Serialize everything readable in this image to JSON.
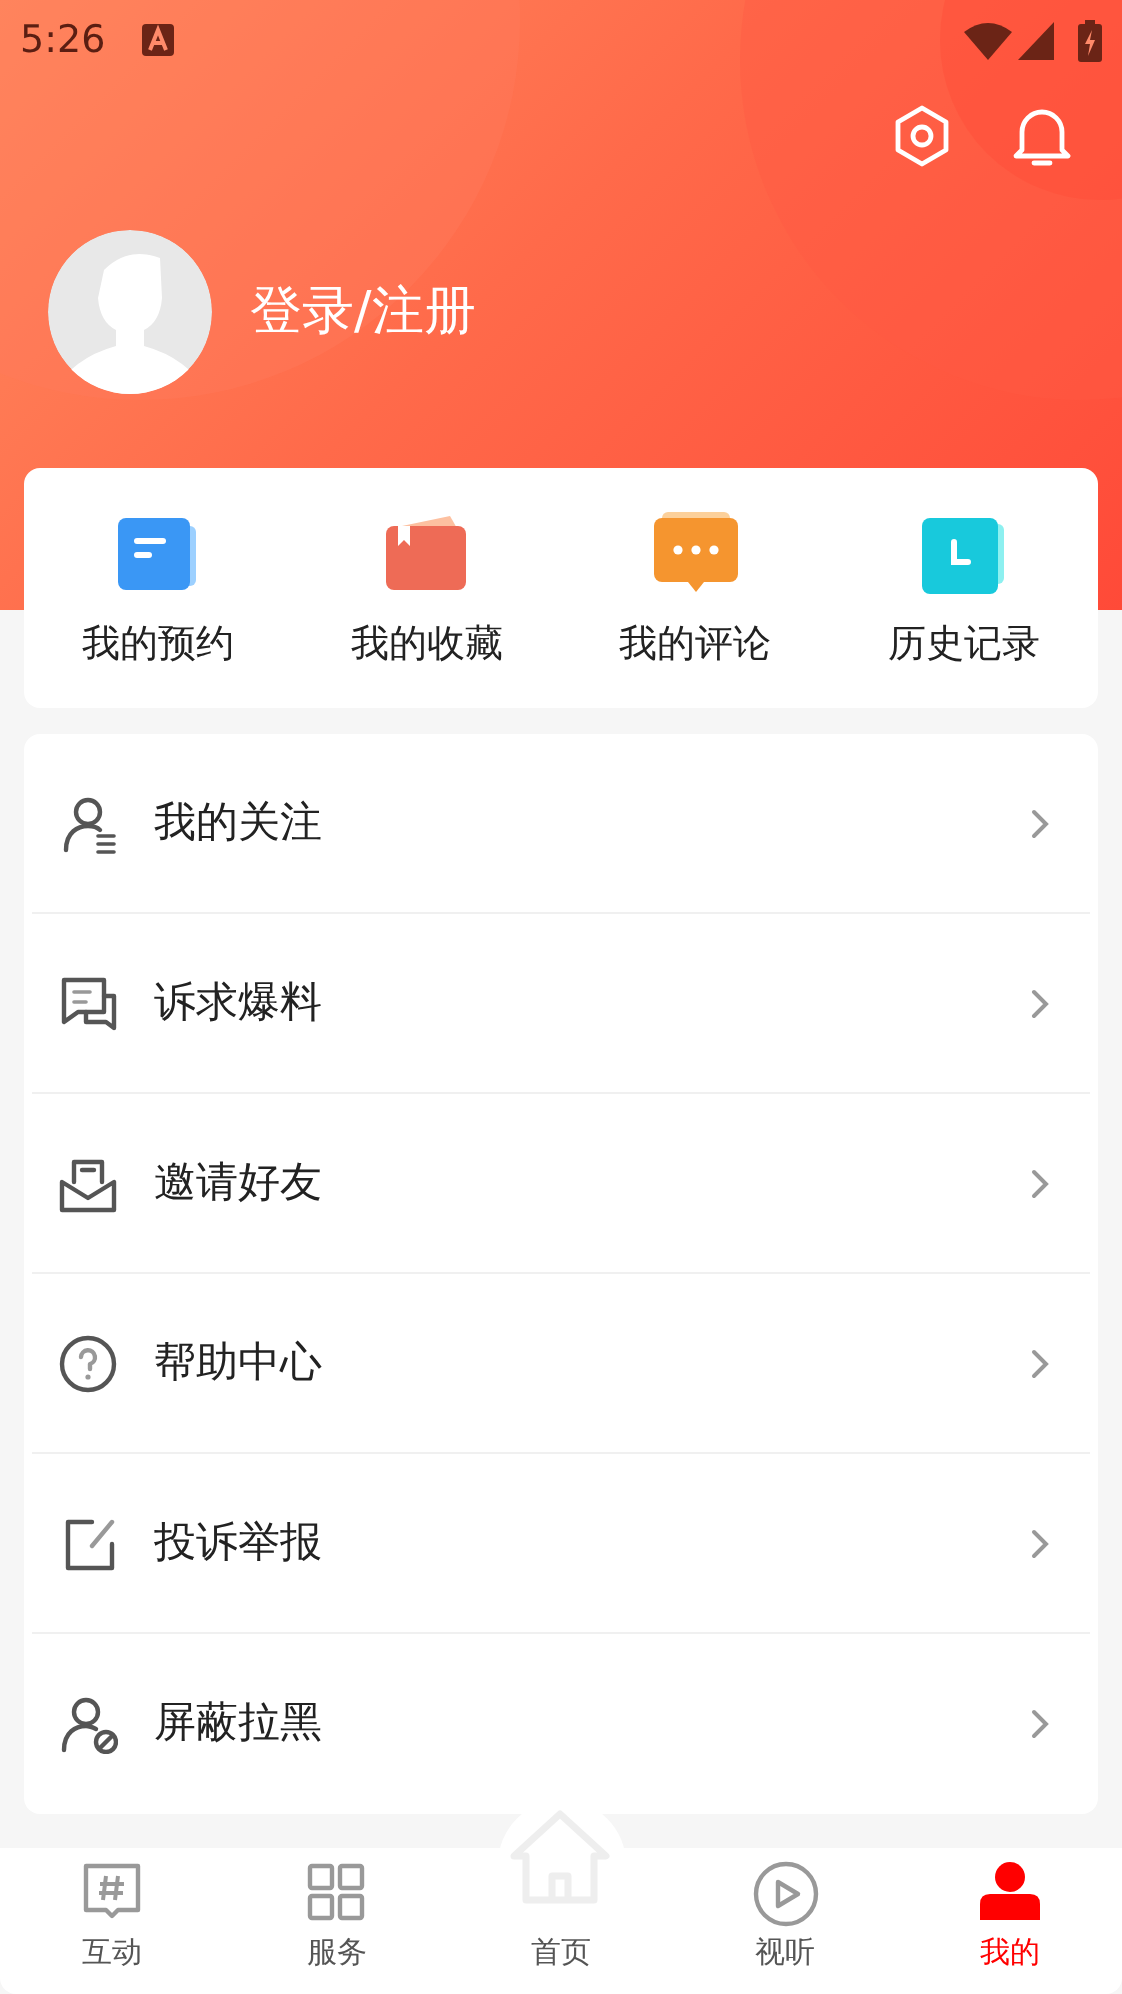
{
  "status_bar": {
    "time": "5:26"
  },
  "profile": {
    "login_label": "登录/注册"
  },
  "shortcuts": [
    {
      "label": "我的预约"
    },
    {
      "label": "我的收藏"
    },
    {
      "label": "我的评论"
    },
    {
      "label": "历史记录"
    }
  ],
  "menu": [
    {
      "label": "我的关注"
    },
    {
      "label": "诉求爆料"
    },
    {
      "label": "邀请好友"
    },
    {
      "label": "帮助中心"
    },
    {
      "label": "投诉举报"
    },
    {
      "label": "屏蔽拉黑"
    }
  ],
  "tab_bar": [
    {
      "label": "互动",
      "selected": false
    },
    {
      "label": "服务",
      "selected": false
    },
    {
      "label": "首页",
      "selected": false
    },
    {
      "label": "视听",
      "selected": false
    },
    {
      "label": "我的",
      "selected": true
    }
  ]
}
